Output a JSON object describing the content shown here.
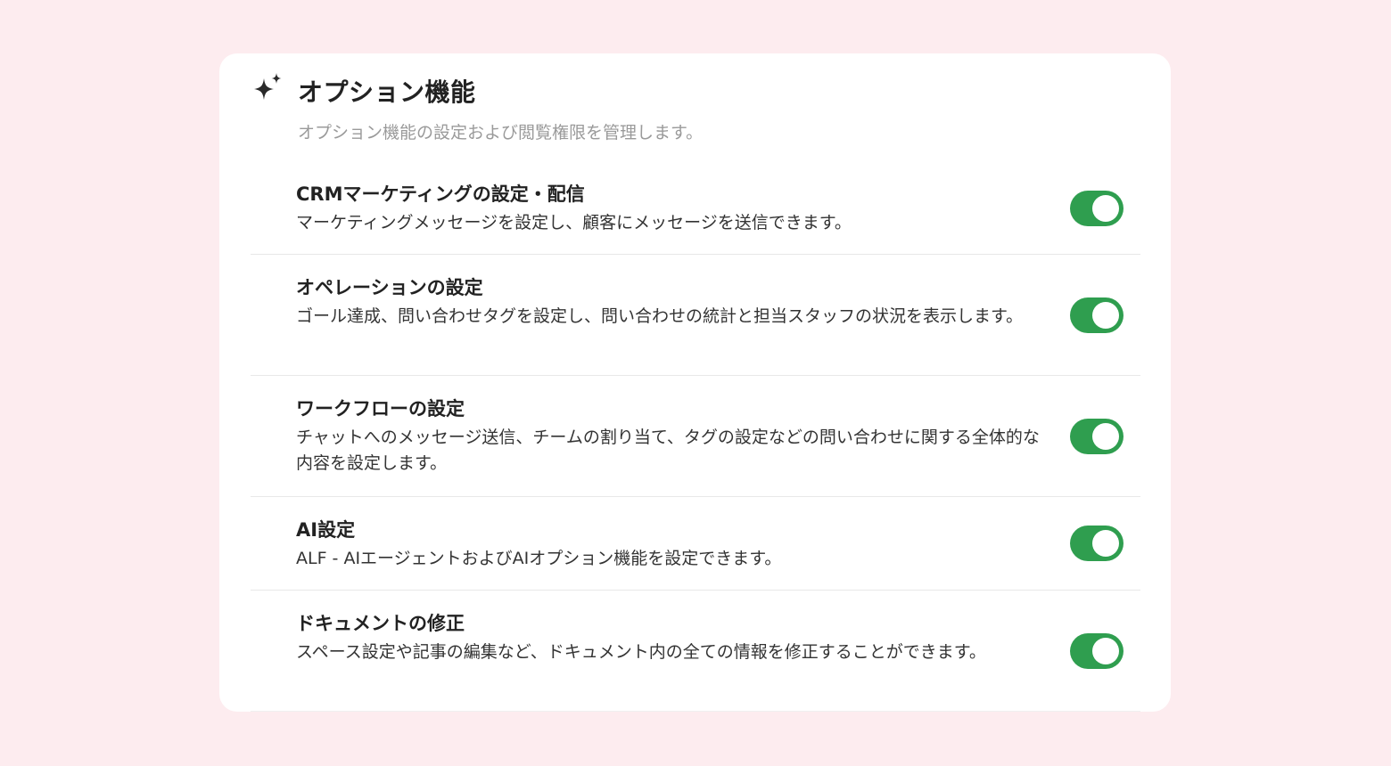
{
  "header": {
    "icon": "sparkle-icon",
    "title": "オプション機能",
    "subtitle": "オプション機能の設定および閲覧権限を管理します。"
  },
  "colors": {
    "background": "#fdecef",
    "card": "#ffffff",
    "toggle_on": "#2f9e4f"
  },
  "settings": [
    {
      "title": "CRMマーケティングの設定・配信",
      "description": "マーケティングメッセージを設定し、顧客にメッセージを送信できます。",
      "enabled": true
    },
    {
      "title": "オペレーションの設定",
      "description": "ゴール達成、問い合わせタグを設定し、問い合わせの統計と担当スタッフの状況を表示します。",
      "enabled": true
    },
    {
      "title": "ワークフローの設定",
      "description": "チャットへのメッセージ送信、チームの割り当て、タグの設定などの問い合わせに関する全体的な内容を設定します。",
      "enabled": true
    },
    {
      "title": "AI設定",
      "description": "ALF - AIエージェントおよびAIオプション機能を設定できます。",
      "enabled": true
    },
    {
      "title": "ドキュメントの修正",
      "description": "スペース設定や記事の編集など、ドキュメント内の全ての情報を修正することができます。",
      "enabled": true
    }
  ]
}
